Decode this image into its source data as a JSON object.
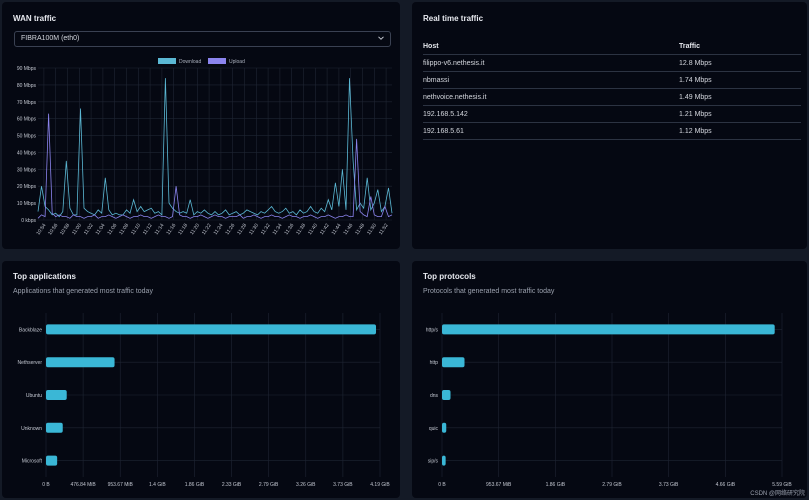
{
  "wan": {
    "title": "WAN traffic",
    "interface": "FIBRA100M (eth0)",
    "legend": [
      "Download",
      "Upload"
    ],
    "colors": {
      "download": "#5bb8d4",
      "upload": "#8b84ee"
    }
  },
  "realtime": {
    "title": "Real time traffic",
    "headers": [
      "Host",
      "Traffic"
    ],
    "rows": [
      [
        "filippo-v6.nethesis.it",
        "12.8 Mbps"
      ],
      [
        "nbmassi",
        "1.74 Mbps"
      ],
      [
        "nethvoice.nethesis.it",
        "1.49 Mbps"
      ],
      [
        "192.168.5.142",
        "1.21 Mbps"
      ],
      [
        "192.168.5.61",
        "1.12 Mbps"
      ]
    ]
  },
  "apps": {
    "title": "Top applications",
    "subtitle": "Applications that generated most traffic today"
  },
  "protocols": {
    "title": "Top protocols",
    "subtitle": "Protocols that generated most traffic today"
  },
  "watermark": "CSDN @网络研究院",
  "chart_data": [
    {
      "type": "line",
      "title": "",
      "yticks": [
        "0 kbps",
        "10 Mbps",
        "20 Mbps",
        "30 Mbps",
        "40 Mbps",
        "50 Mbps",
        "60 Mbps",
        "70 Mbps",
        "80 Mbps",
        "90 Mbps"
      ],
      "ylim": [
        0,
        90
      ],
      "x": [
        "10:54",
        "10:56",
        "10:58",
        "11:00",
        "11:02",
        "11:04",
        "11:06",
        "11:08",
        "11:10",
        "11:12",
        "11:14",
        "11:16",
        "11:18",
        "11:20",
        "11:22",
        "11:24",
        "11:26",
        "11:28",
        "11:30",
        "11:32",
        "11:34",
        "11:36",
        "11:38",
        "11:40",
        "11:42",
        "11:44",
        "11:46",
        "11:48",
        "11:50",
        "11:52"
      ],
      "series": [
        {
          "name": "Download",
          "values": [
            5,
            20,
            8,
            6,
            3,
            4,
            2,
            5,
            35,
            7,
            3,
            3,
            66,
            7,
            5,
            4,
            3,
            6,
            4,
            25,
            6,
            3,
            4,
            3,
            3,
            6,
            4,
            12,
            5,
            8,
            5,
            6,
            7,
            4,
            5,
            3,
            84,
            10,
            7,
            5,
            4,
            5,
            4,
            12,
            3,
            5,
            4,
            6,
            4,
            3,
            5,
            3,
            4,
            6,
            3,
            4,
            5,
            3,
            4,
            6,
            5,
            4,
            3,
            5,
            4,
            6,
            8,
            5,
            4,
            5,
            7,
            4,
            5,
            3,
            6,
            4,
            5,
            8,
            5,
            4,
            7,
            5,
            12,
            6,
            22,
            8,
            30,
            6,
            84,
            35,
            6,
            10,
            7,
            25,
            6,
            10,
            18,
            5,
            8,
            19,
            4
          ]
        },
        {
          "name": "Upload",
          "values": [
            1,
            3,
            2,
            63,
            4,
            2,
            3,
            2,
            2,
            1,
            3,
            2,
            2,
            1,
            2,
            2,
            3,
            1,
            2,
            2,
            3,
            2,
            1,
            2,
            3,
            2,
            1,
            2,
            2,
            3,
            2,
            2,
            1,
            2,
            3,
            2,
            2,
            1,
            2,
            20,
            3,
            2,
            2,
            1,
            2,
            2,
            3,
            2,
            1,
            2,
            3,
            2,
            2,
            1,
            2,
            2,
            2,
            3,
            1,
            2,
            2,
            3,
            2,
            1,
            2,
            2,
            3,
            2,
            2,
            1,
            2,
            3,
            2,
            2,
            1,
            2,
            2,
            3,
            2,
            1,
            2,
            2,
            3,
            2,
            1,
            2,
            2,
            3,
            2,
            2,
            48,
            5,
            3,
            2,
            14,
            3,
            2,
            2,
            8,
            2,
            3
          ]
        }
      ]
    },
    {
      "type": "bar",
      "categories": [
        "Backblaze",
        "Nethserver",
        "Ubuntu",
        "Unknown",
        "Microsoft"
      ],
      "values": [
        4.14,
        0.86,
        0.26,
        0.21,
        0.14
      ],
      "xticks": [
        "0 B",
        "476.84 MiB",
        "953.67 MiB",
        "1.4 GiB",
        "1.86 GiB",
        "2.33 GiB",
        "2.79 GiB",
        "3.26 GiB",
        "3.73 GiB",
        "4.19 GiB"
      ],
      "xlim": [
        0,
        4.19
      ],
      "unit": "GiB",
      "color": "#3ab7d6"
    },
    {
      "type": "bar",
      "categories": [
        "http/s",
        "http",
        "dns",
        "quic",
        "sip/s"
      ],
      "values": [
        5.47,
        0.37,
        0.14,
        0.07,
        0.06
      ],
      "xticks": [
        "0 B",
        "953.67 MiB",
        "1.86 GiB",
        "2.79 GiB",
        "3.73 GiB",
        "4.66 GiB",
        "5.59 GiB"
      ],
      "xlim": [
        0,
        5.59
      ],
      "unit": "GiB",
      "color": "#3ab7d6"
    }
  ]
}
